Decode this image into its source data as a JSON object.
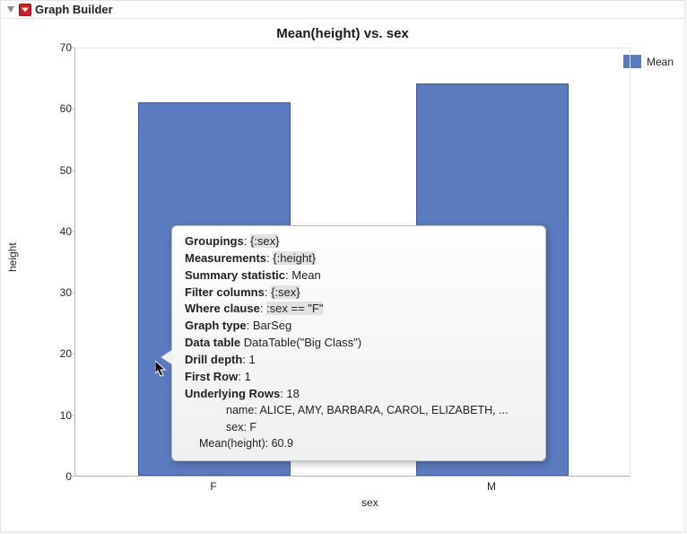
{
  "header": {
    "title": "Graph Builder"
  },
  "chart_data": {
    "type": "bar",
    "title": "Mean(height) vs. sex",
    "xlabel": "sex",
    "ylabel": "height",
    "ylim": [
      0,
      70
    ],
    "yticks": [
      0,
      10,
      20,
      30,
      40,
      50,
      60,
      70
    ],
    "categories": [
      "F",
      "M"
    ],
    "values": [
      60.9,
      64
    ],
    "legend": [
      {
        "name": "Mean",
        "color": "#5c7abf"
      }
    ]
  },
  "tooltip": {
    "groupings_label": "Groupings",
    "groupings_value": "{:sex}",
    "measurements_label": "Measurements",
    "measurements_value": "{:height}",
    "summary_stat_label": "Summary statistic",
    "summary_stat_value": "Mean",
    "filter_cols_label": "Filter columns",
    "filter_cols_value": "{:sex}",
    "where_label": "Where clause",
    "where_value": ":sex == \"F\"",
    "graph_type_label": "Graph type",
    "graph_type_value": "BarSeg",
    "data_table_label": "Data table",
    "data_table_value": "DataTable(\"Big Class\")",
    "drill_depth_label": "Drill depth",
    "drill_depth_value": "1",
    "first_row_label": "First Row",
    "first_row_value": "1",
    "underlying_rows_label": "Underlying Rows",
    "underlying_rows_value": "18",
    "name_row": "name: ALICE, AMY, BARBARA, CAROL, ELIZABETH, ...",
    "sex_row": "sex: F",
    "mean_row": "Mean(height): 60.9"
  }
}
